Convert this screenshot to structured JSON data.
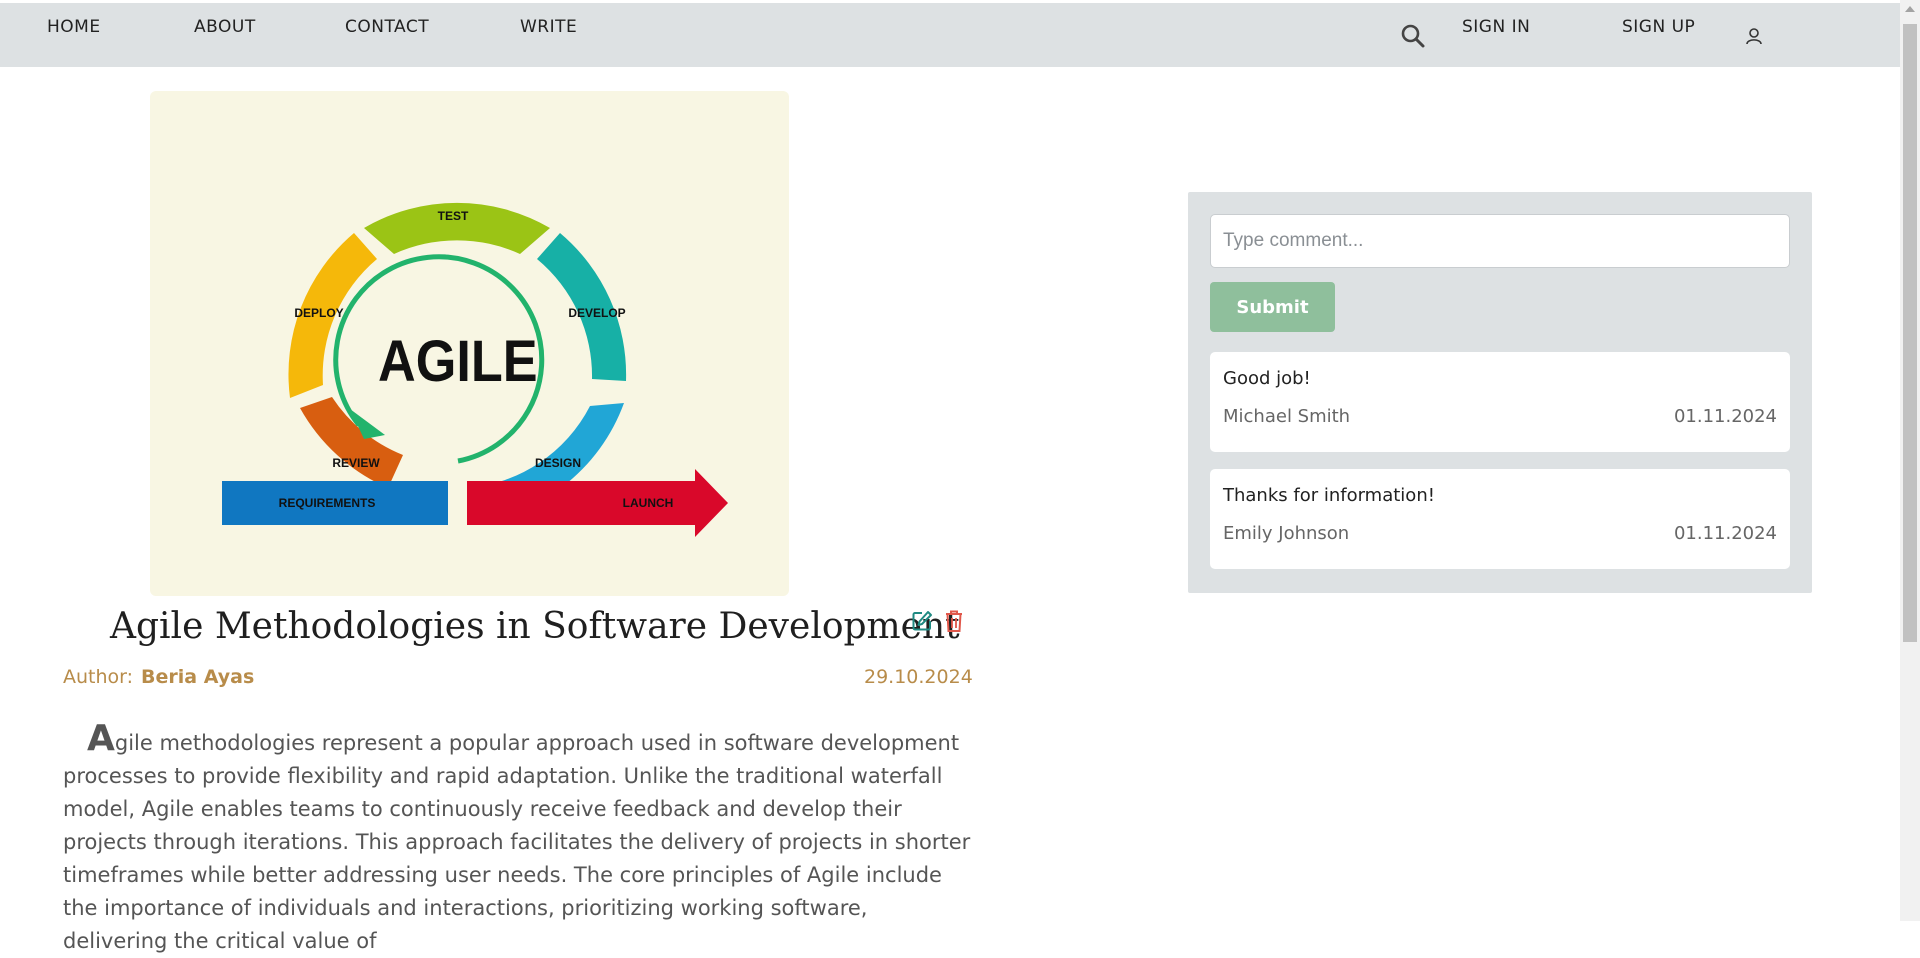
{
  "nav": {
    "home": "HOME",
    "about": "ABOUT",
    "contact": "CONTACT",
    "write": "WRITE",
    "sign_in": "SIGN IN",
    "sign_up": "SIGN UP",
    "search_icon": "search-icon",
    "user_icon": "user-icon"
  },
  "hero_image": {
    "center_label": "AGILE",
    "segments": [
      "TEST",
      "DEVELOP",
      "DESIGN",
      "REVIEW",
      "DEPLOY"
    ],
    "bottom_left_label": "REQUIREMENTS",
    "bottom_right_label": "LAUNCH"
  },
  "post": {
    "title": "Agile Methodologies in Software Development",
    "author_label": "Author:",
    "author_name": "Beria Ayas",
    "date": "29.10.2024",
    "body_first_letter": "A",
    "body_rest": "gile methodologies represent a popular approach used in software development processes to provide flexibility and rapid adaptation. Unlike the traditional waterfall model, Agile enables teams to continuously receive feedback and develop their projects through iterations. This approach facilitates the delivery of projects in shorter timeframes while better addressing user needs. The core principles of Agile include the importance of individuals and interactions, prioritizing working software, delivering the critical value of",
    "edit_icon": "edit-icon",
    "delete_icon": "trash-icon"
  },
  "comments": {
    "placeholder": "Type comment...",
    "submit_label": "Submit",
    "items": [
      {
        "text": "Good job!",
        "author": "Michael Smith",
        "date": "01.11.2024"
      },
      {
        "text": "Thanks for information!",
        "author": "Emily Johnson",
        "date": "01.11.2024"
      }
    ]
  },
  "colors": {
    "nav_bg": "#dde1e3",
    "accent_gold": "#b88c4a",
    "submit_green": "#8fbf9c",
    "edit_teal": "#1f8a82",
    "delete_red": "#e0574a"
  }
}
